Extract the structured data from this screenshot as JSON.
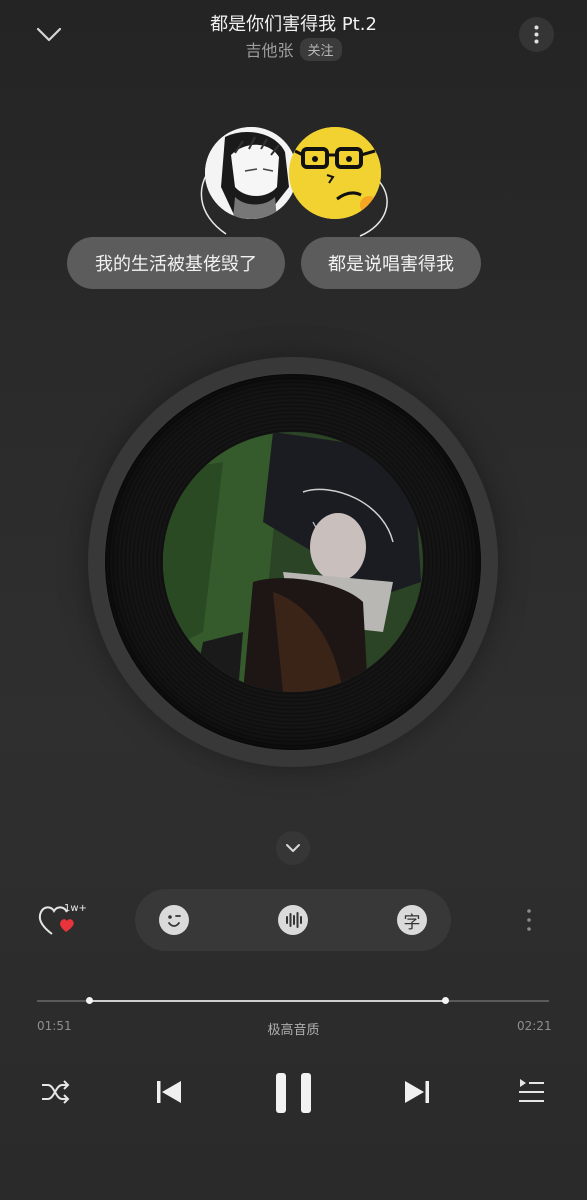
{
  "header": {
    "song_title": "都是你们害得我 Pt.2",
    "artist": "吉他张",
    "follow_label": "关注"
  },
  "bubbles": {
    "left_text": "我的生活被基佬毁了",
    "right_text": "都是说唱害得我"
  },
  "actions": {
    "like_count": "1w+",
    "liked": true,
    "icons": [
      "emoji-icon",
      "sound-wave-icon",
      "lyrics-char-icon"
    ],
    "lyrics_char": "字"
  },
  "playback": {
    "current_time": "01:51",
    "total_time": "02:21",
    "quality": "极高音质",
    "progress": 0.102,
    "buffered": 0.797
  },
  "controls": {
    "buttons": [
      "shuffle-icon",
      "previous-icon",
      "pause-icon",
      "next-icon",
      "playlist-icon"
    ]
  },
  "colors": {
    "background": "#2b2b2b",
    "bubble": "#5c5c5c",
    "heart": "#e8343a",
    "avatar_b": "#f2d230"
  }
}
